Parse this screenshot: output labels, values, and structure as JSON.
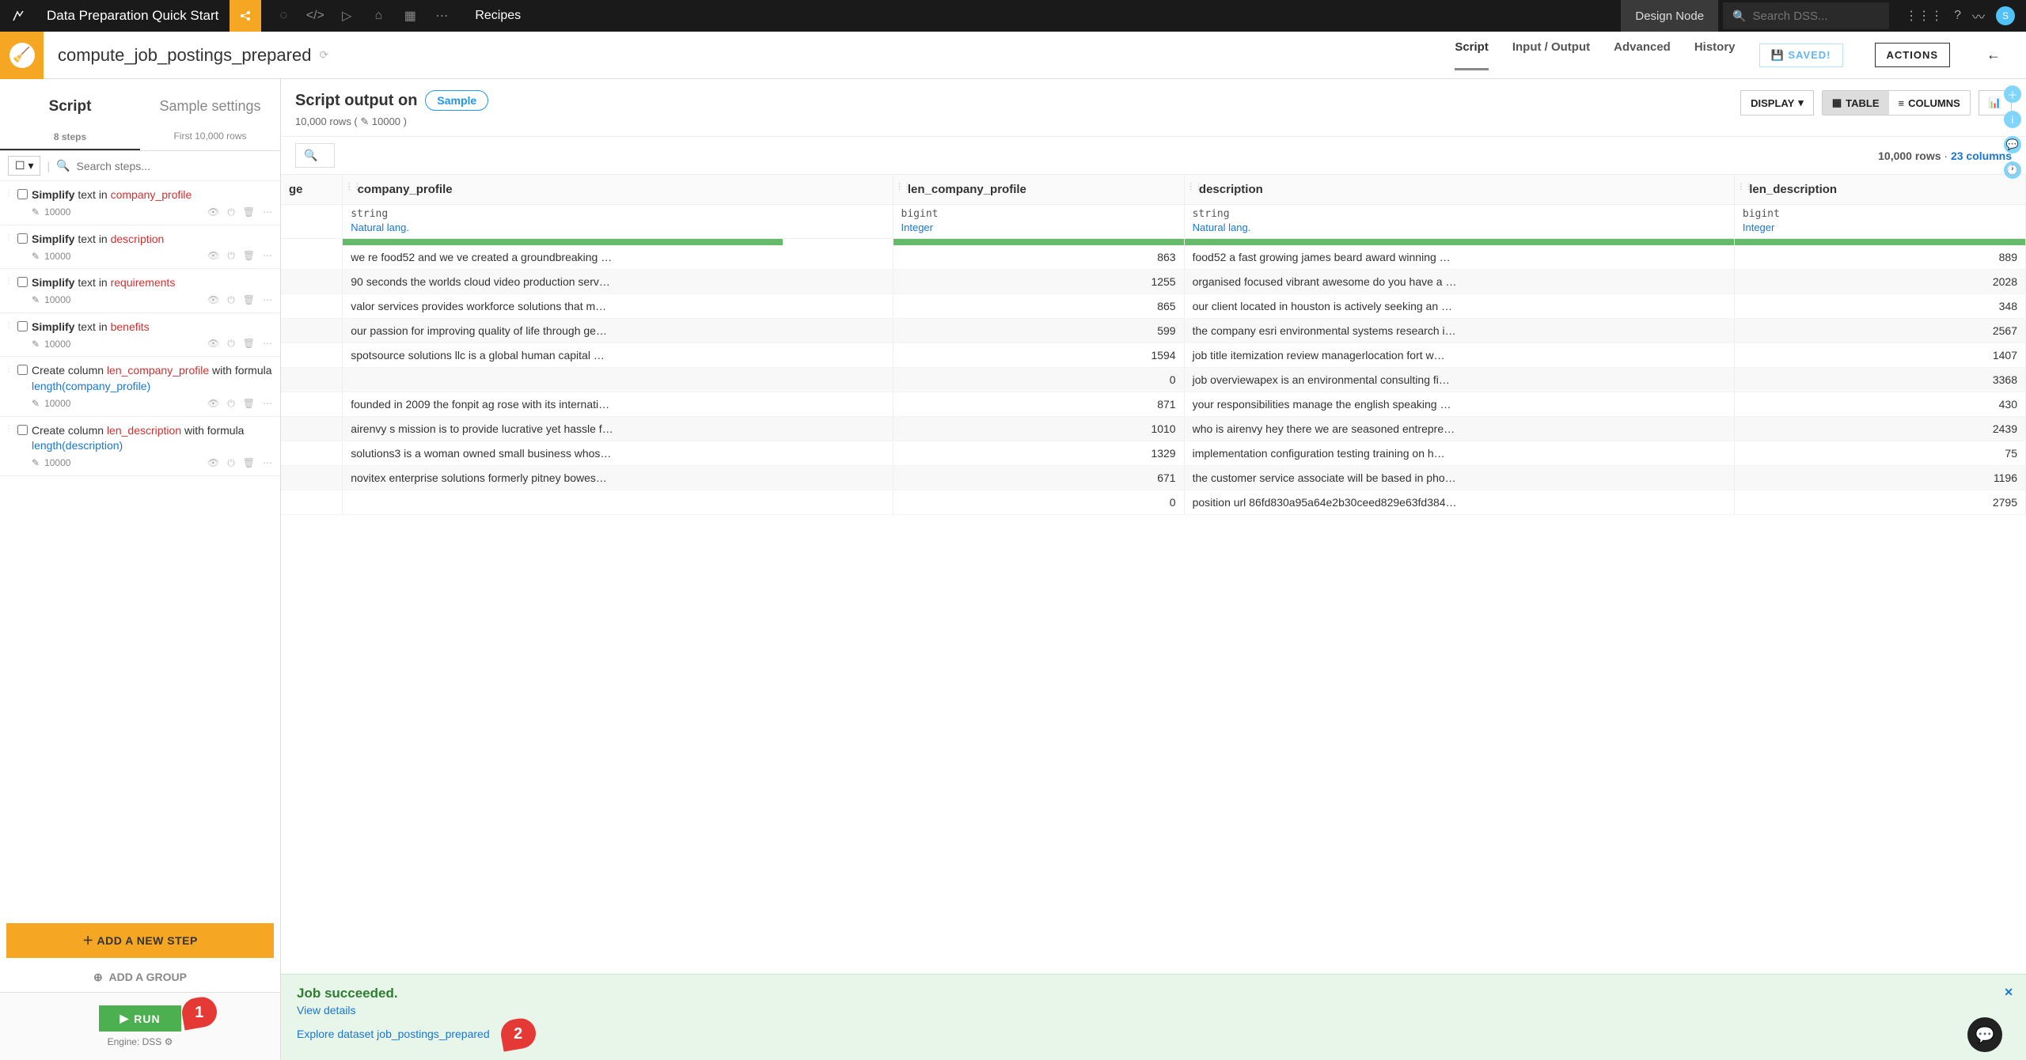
{
  "topbar": {
    "breadcrumb": "Data Preparation Quick Start",
    "section": "Recipes",
    "node": "Design Node",
    "search_placeholder": "Search DSS...",
    "avatar": "S"
  },
  "recipe": {
    "name": "compute_job_postings_prepared",
    "tabs": {
      "script": "Script",
      "io": "Input / Output",
      "advanced": "Advanced",
      "history": "History"
    },
    "saved": "SAVED!",
    "actions": "ACTIONS"
  },
  "left": {
    "script_tab": "Script",
    "sample_tab": "Sample settings",
    "steps_count": "8 steps",
    "sample_sub": "First 10,000 rows",
    "search_placeholder": "Search steps...",
    "add_step": "ADD A NEW STEP",
    "add_group": "ADD A GROUP",
    "run": "RUN",
    "engine": "Engine: DSS ⚙"
  },
  "steps": [
    {
      "html": "<b>Simplify</b> text in <span class='red'>company_profile</span>",
      "count": "10000"
    },
    {
      "html": "<b>Simplify</b> text in <span class='red'>description</span>",
      "count": "10000"
    },
    {
      "html": "<b>Simplify</b> text in <span class='red'>requirements</span>",
      "count": "10000"
    },
    {
      "html": "<b>Simplify</b> text in <span class='red'>benefits</span>",
      "count": "10000"
    },
    {
      "html": "Create column <span class='red'>len_company_profile</span> with formula <span class='blue'>length(company_profile)</span>",
      "count": "10000"
    },
    {
      "html": "Create column <span class='red'>len_description</span> with formula <span class='blue'>length(description)</span>",
      "count": "10000"
    }
  ],
  "output": {
    "title": "Script output on",
    "sample": "Sample",
    "sub": "10,000 rows  ( ✎ 10000 )",
    "display": "DISPLAY",
    "table": "TABLE",
    "columns": "COLUMNS",
    "stats_rows": "10,000 rows",
    "stats_cols": "23 columns"
  },
  "table": {
    "cols": [
      {
        "name": "company_profile",
        "type": "string",
        "sem": "Natural lang.",
        "bar": 80
      },
      {
        "name": "len_company_profile",
        "type": "bigint",
        "sem": "Integer",
        "bar": 100
      },
      {
        "name": "description",
        "type": "string",
        "sem": "Natural lang.",
        "bar": 100
      },
      {
        "name": "len_description",
        "type": "bigint",
        "sem": "Integer",
        "bar": 100
      }
    ],
    "rows": [
      [
        "we re food52 and we ve created a groundbreaking …",
        "863",
        "food52 a fast growing james beard award winning …",
        "889"
      ],
      [
        "90 seconds the worlds cloud video production serv…",
        "1255",
        "organised focused vibrant awesome do you have a …",
        "2028"
      ],
      [
        "valor services provides workforce solutions that m…",
        "865",
        "our client located in houston is actively seeking an …",
        "348"
      ],
      [
        "our passion for improving quality of life through ge…",
        "599",
        "the company esri environmental systems research i…",
        "2567"
      ],
      [
        "spotsource solutions llc is a global human capital …",
        "1594",
        "job title itemization review managerlocation fort w…",
        "1407"
      ],
      [
        "",
        "0",
        "job overviewapex is an environmental consulting fi…",
        "3368"
      ],
      [
        "founded in 2009 the fonpit ag rose with its internati…",
        "871",
        "your responsibilities manage the english speaking …",
        "430"
      ],
      [
        "airenvy s mission is to provide lucrative yet hassle f…",
        "1010",
        "who is airenvy hey there we are seasoned entrepre…",
        "2439"
      ],
      [
        "solutions3 is a woman owned small business whos…",
        "1329",
        "implementation configuration testing training on h…",
        "75"
      ],
      [
        "novitex enterprise solutions formerly pitney bowes…",
        "671",
        "the customer service associate will be based in pho…",
        "1196"
      ],
      [
        "",
        "0",
        "position url 86fd830a95a64e2b30ceed829e63fd384…",
        "2795"
      ]
    ]
  },
  "success": {
    "title": "Job succeeded.",
    "details": "View details",
    "explore": "Explore dataset job_postings_prepared"
  },
  "callouts": {
    "one": "1",
    "two": "2"
  }
}
